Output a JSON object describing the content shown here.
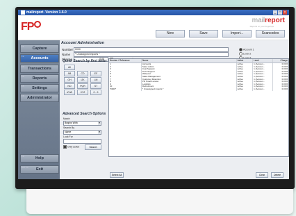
{
  "window": {
    "title": "mailreport. Version 1.6.0",
    "controls": [
      "_",
      "□",
      "×"
    ]
  },
  "brand": {
    "logo_left": "FP",
    "logo_right_prefix": "mail",
    "logo_right_accent": "report",
    "logo_right_sub": "Reports on your fingertips"
  },
  "toolbar": {
    "new": "New",
    "save": "Save",
    "import": "Import...",
    "scan": "Scancodes"
  },
  "sidebar": {
    "items": [
      {
        "num": "F1",
        "label": "Capture"
      },
      {
        "num": "F2",
        "label": "Accounts"
      },
      {
        "num": "F3",
        "label": "Transactions"
      },
      {
        "num": "F4",
        "label": "Reports"
      },
      {
        "num": "F5",
        "label": "Settings"
      },
      {
        "num": "F6",
        "label": "Administrator"
      }
    ],
    "help": {
      "num": "F9",
      "label": "Help"
    },
    "exit": {
      "num": "ALT F4",
      "label": "Exit"
    }
  },
  "account": {
    "section_title": "Account Administration",
    "number_label": "Number",
    "number_value": "0000",
    "name_label": "Name",
    "name_value": "* Unassigned imports *",
    "charge_label": "Charge",
    "charge_value": "0.00",
    "pct_label": "Percentage charge",
    "levels": [
      "Account 1",
      "Level 2",
      "Level 3"
    ],
    "active_label": "Account active"
  },
  "quick": {
    "title": "Quick Search by first letter",
    "letters": [
      "All",
      "AB",
      "CD",
      "EF",
      "GH",
      "IJK",
      "LM",
      "NO",
      "PQR",
      "ST",
      "UVW",
      "XYZ",
      "0 - 9"
    ]
  },
  "advanced": {
    "title": "Advanced Search Options",
    "match_label": "Match",
    "match_value": "Begins With",
    "searchby_label": "Search By",
    "searchby_value": "Name",
    "lookfor_label": "Look For",
    "only_active": "Only active",
    "search_btn": "Search"
  },
  "grid": {
    "headers": [
      "Number / Reference",
      "Name",
      "Active",
      "Level",
      "Charge"
    ],
    "rows": [
      [
        "1",
        "Accounts",
        "Active",
        "1 (Accoun...",
        "0.00 €"
      ],
      [
        "2",
        "Sales Admin",
        "Active",
        "1 (Accoun...",
        "0.00 €"
      ],
      [
        "3",
        "Cust Support",
        "Active",
        "1 (Accoun...",
        "0.00 €"
      ],
      [
        "4",
        "Tech Support",
        "Active",
        "1 (Accoun...",
        "0.00 €"
      ],
      [
        "5",
        "Webpool",
        "Active",
        "1 (Accoun...",
        "0.00 €"
      ],
      [
        "6",
        "Sales Management",
        "Active",
        "1 (Accoun...",
        "0.00 €"
      ],
      [
        "7",
        "Customer Retention",
        "Active",
        "1 (Accoun...",
        "0.00 €"
      ],
      [
        "8",
        "PR Small London",
        "Active",
        "1 (Accoun...",
        "0.00 €"
      ],
      [
        "9",
        "Logistics",
        "Active",
        "1 (Accoun...",
        "0.00 €"
      ],
      [
        "10",
        "Recruitment",
        "Active",
        "1 (Accoun...",
        "0.00 €"
      ],
      [
        "*0000*",
        "* Unassigned imports *",
        "Active",
        "1 (Accoun...",
        "0.00 €"
      ]
    ]
  },
  "bottom": {
    "select_all": "Select All",
    "clear": "Clear",
    "delete": "Delete"
  }
}
